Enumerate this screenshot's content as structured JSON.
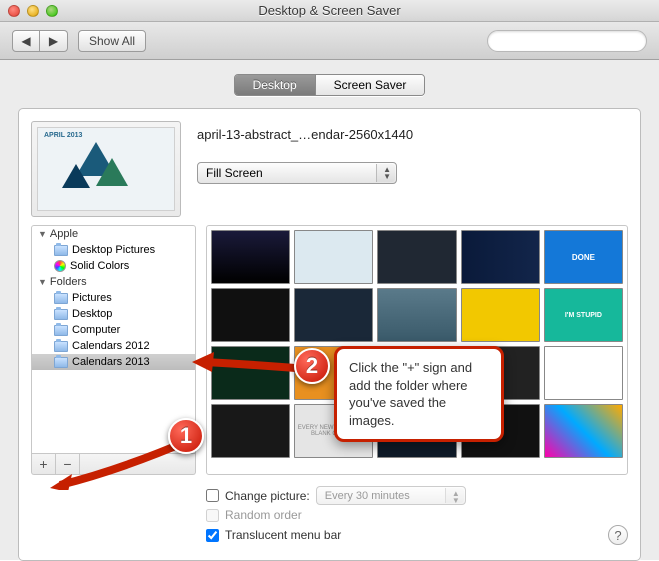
{
  "title": "Desktop & Screen Saver",
  "toolbar": {
    "show_all": "Show All"
  },
  "tabs": {
    "desktop": "Desktop",
    "screensaver": "Screen Saver"
  },
  "wallpaper": {
    "name": "april-13-abstract_…endar-2560x1440",
    "fit_mode": "Fill Screen",
    "preview_label": "APRIL 2013"
  },
  "sidebar": {
    "groups": [
      {
        "label": "Apple",
        "items": [
          {
            "label": "Desktop Pictures",
            "icon": "folder"
          },
          {
            "label": "Solid Colors",
            "icon": "color"
          }
        ]
      },
      {
        "label": "Folders",
        "items": [
          {
            "label": "Pictures",
            "icon": "folder"
          },
          {
            "label": "Desktop",
            "icon": "folder"
          },
          {
            "label": "Computer",
            "icon": "folder"
          },
          {
            "label": "Calendars 2012",
            "icon": "folder"
          },
          {
            "label": "Calendars 2013",
            "icon": "folder",
            "selected": true
          }
        ]
      }
    ]
  },
  "thumb_labels": {
    "t5": "DONE",
    "t10": "I'M STUPID",
    "t17": "EVERY NEW MONTH IS A BLANK CANVAS"
  },
  "options": {
    "change_picture": "Change picture:",
    "interval": "Every 30 minutes",
    "random": "Random order",
    "translucent": "Translucent menu bar"
  },
  "callouts": {
    "b1": "1",
    "b2": "2",
    "text": "Click the \"+\" sign and add the folder where you've saved the images."
  }
}
